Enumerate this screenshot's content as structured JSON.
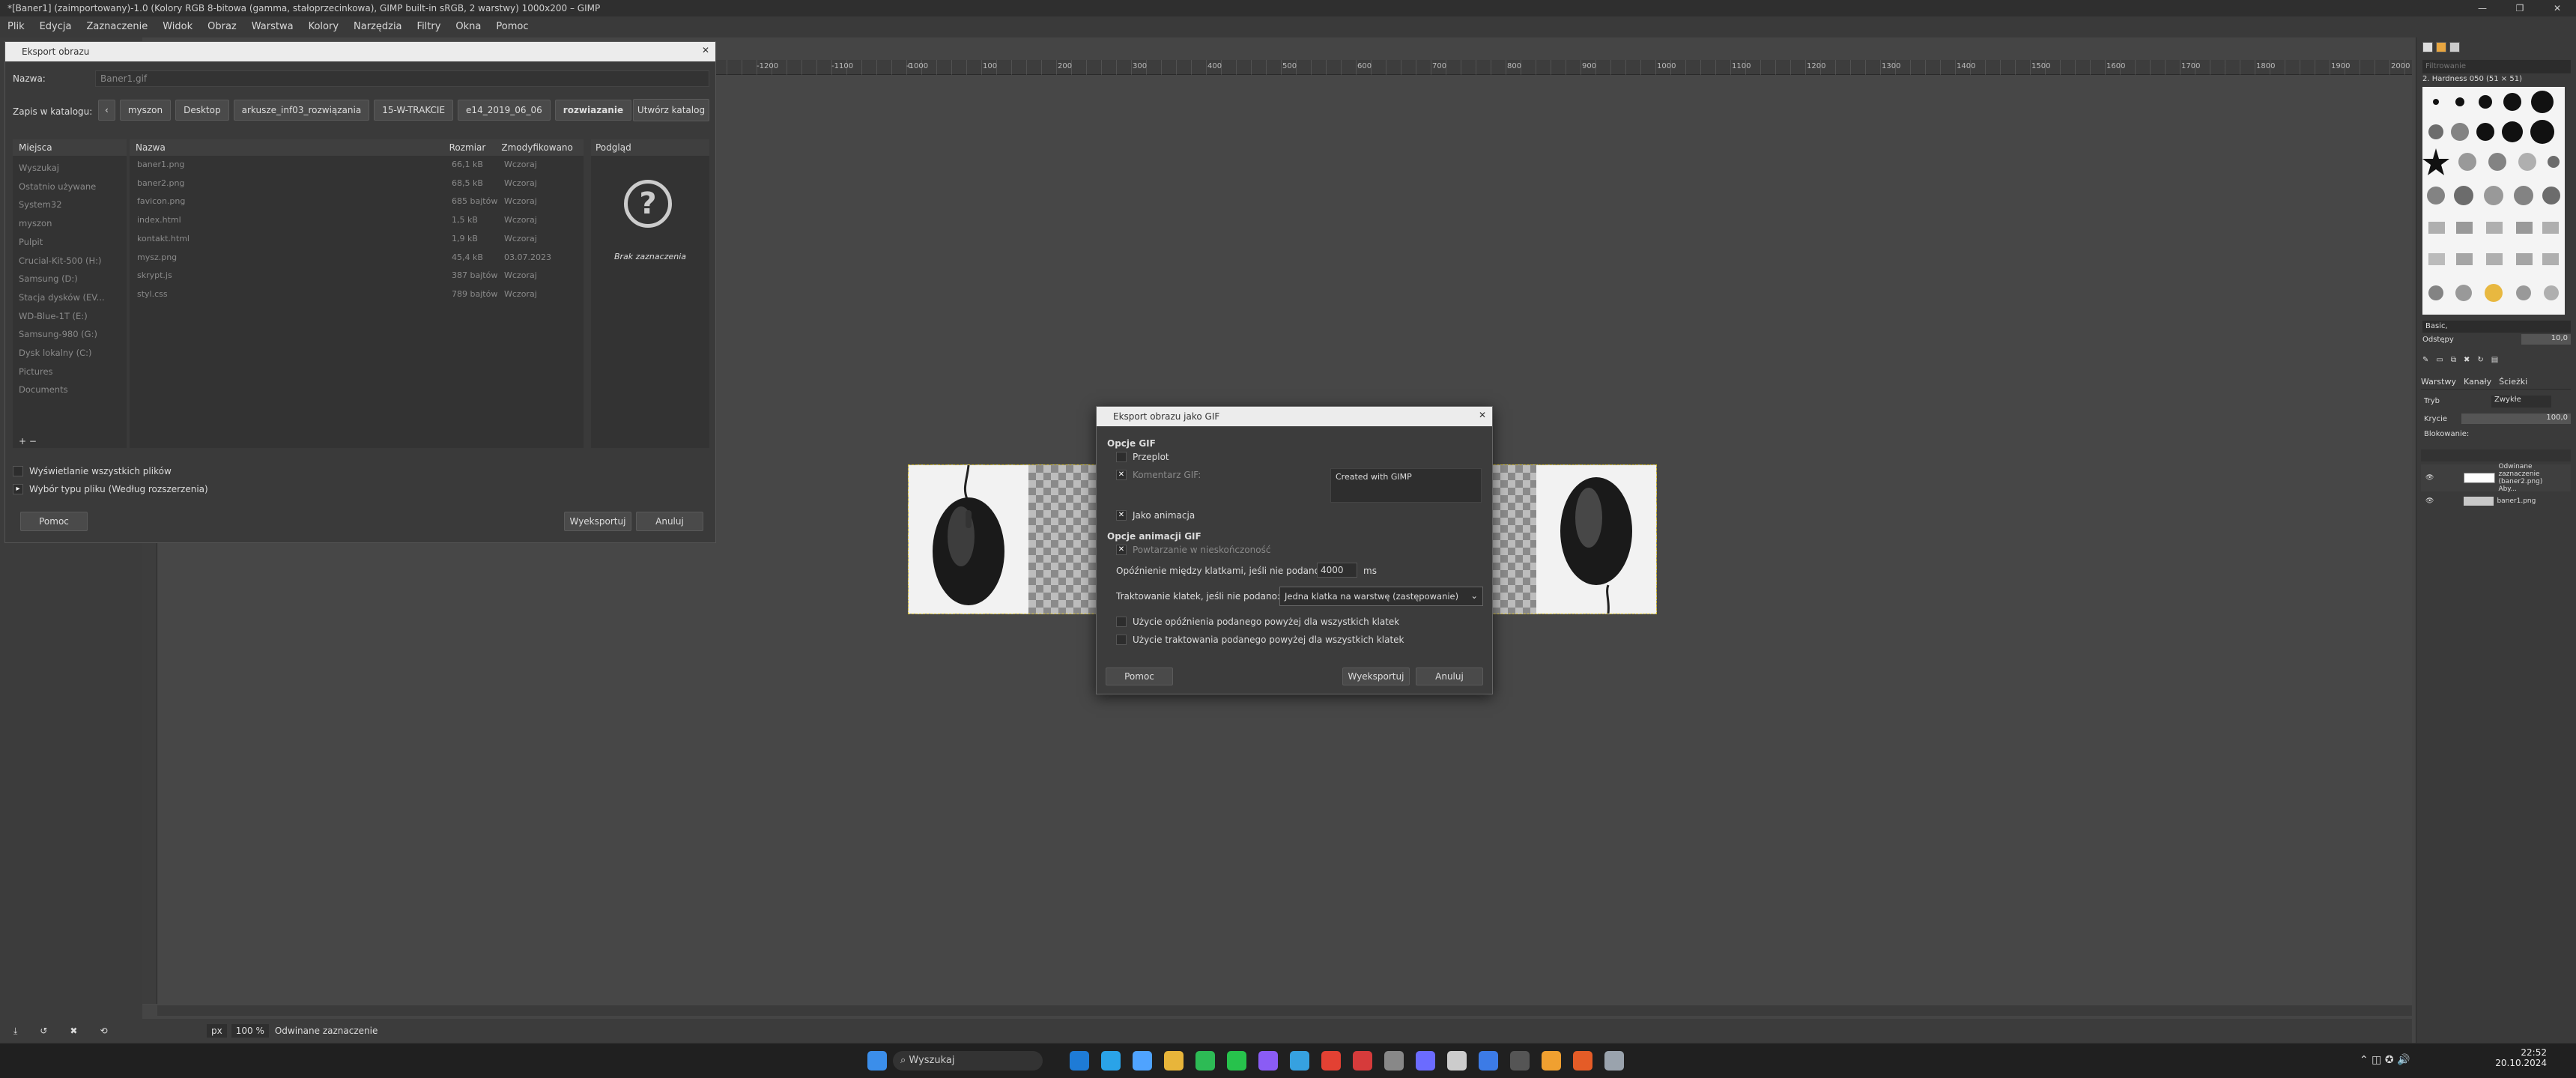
{
  "window": {
    "title": "*[Baner1] (zaimportowany)-1.0 (Kolory RGB 8-bitowa (gamma, stałoprzecinkowa), GIMP built-in sRGB, 2 warstwy) 1000x200 – GIMP",
    "controls": [
      "—",
      "❐",
      "✕"
    ]
  },
  "menu": [
    "Plik",
    "Edycja",
    "Zaznaczenie",
    "Widok",
    "Obraz",
    "Warstwa",
    "Kolory",
    "Narzędzia",
    "Filtry",
    "Okna",
    "Pomoc"
  ],
  "ruler": {
    "h_ticks": [
      "-1200",
      "-1100",
      "-1000",
      "0",
      "100",
      "200",
      "300",
      "400",
      "500",
      "600",
      "700",
      "800",
      "900",
      "1000",
      "1100",
      "1200",
      "1300",
      "1400",
      "1500",
      "1600",
      "1700",
      "1800",
      "1900",
      "2000"
    ]
  },
  "status": {
    "unit": "px",
    "zoom": "100 %",
    "text": "Odwinane zaznaczenie"
  },
  "export_dialog": {
    "title": "Eksport obrazu",
    "name_label": "Nazwa:",
    "name_value": "Baner1.gif",
    "folder_label": "Zapis w katalogu:",
    "breadcrumbs": [
      "myszon",
      "Desktop",
      "arkusze_inf03_rozwiązania",
      "15-W-TRAKCIE",
      "e14_2019_06_06",
      "rozwiazanie"
    ],
    "create_folder": "Utwórz katalog",
    "places_header": "Miejsca",
    "places": [
      "Wyszukaj",
      "Ostatnio używane",
      "System32",
      "myszon",
      "Pulpit",
      "Crucial-Kit-500 (H:)",
      "Samsung (D:)",
      "Stacja dysków (EV...",
      "WD-Blue-1T (E:)",
      "Samsung-980 (G:)",
      "Dysk lokalny (C:)",
      "Pictures",
      "Documents"
    ],
    "columns": {
      "name": "Nazwa",
      "size": "Rozmiar",
      "modified": "Zmodyfikowano"
    },
    "files": [
      {
        "name": "baner1.png",
        "size": "66,1 kB",
        "modified": "Wczoraj"
      },
      {
        "name": "baner2.png",
        "size": "68,5 kB",
        "modified": "Wczoraj"
      },
      {
        "name": "favicon.png",
        "size": "685 bajtów",
        "modified": "Wczoraj"
      },
      {
        "name": "index.html",
        "size": "1,5 kB",
        "modified": "Wczoraj"
      },
      {
        "name": "kontakt.html",
        "size": "1,9 kB",
        "modified": "Wczoraj"
      },
      {
        "name": "mysz.png",
        "size": "45,4 kB",
        "modified": "03.07.2023"
      },
      {
        "name": "skrypt.js",
        "size": "387 bajtów",
        "modified": "Wczoraj"
      },
      {
        "name": "styl.css",
        "size": "789 bajtów",
        "modified": "Wczoraj"
      }
    ],
    "preview_header": "Podgląd",
    "preview_empty": "Brak zaznaczenia",
    "show_all": "Wyświetlanie wszystkich plików",
    "file_type": "Wybór typu pliku (Według rozszerzenia)",
    "help": "Pomoc",
    "export": "Wyeksportuj",
    "cancel": "Anuluj"
  },
  "gif_dialog": {
    "title": "Eksport obrazu jako GIF",
    "section1": "Opcje GIF",
    "interlace": "Przeplot",
    "comment_label": "Komentarz GIF:",
    "comment_value": "Created with GIMP",
    "as_animation": "Jako animacja",
    "section2": "Opcje animacji GIF",
    "loop_forever": "Powtarzanie w nieskończoność",
    "delay_label": "Opóźnienie między klatkami, jeśli nie podano:",
    "delay_value": "4000",
    "delay_unit": "ms",
    "disposal_label": "Traktowanie klatek, jeśli nie podano:",
    "disposal_value": "Jedna klatka na warstwę (zastępowanie)",
    "use_delay_all": "Użycie opóźnienia podanego powyżej dla wszystkich klatek",
    "use_disposal_all": "Użycie traktowania podanego powyżej dla wszystkich klatek",
    "help": "Pomoc",
    "export": "Wyeksportuj",
    "cancel": "Anuluj"
  },
  "right_dock": {
    "filter_placeholder": "Filtrowanie",
    "brush_name": "2. Hardness 050 (51 × 51)",
    "brush_preset": "Basic,",
    "spacing_label": "Odstępy",
    "spacing_value": "10,0",
    "tabs": [
      "Warstwy",
      "Kanały",
      "Ścieżki"
    ],
    "mode_label": "Tryb",
    "mode_value": "Zwykłe",
    "opacity_label": "Krycie",
    "opacity_value": "100,0",
    "lock_label": "Blokowanie:",
    "layers": [
      "Odwinane zaznaczenie (baner2.png) Aby...",
      "baner1.png"
    ]
  },
  "taskbar": {
    "search_placeholder": "Wyszukaj",
    "time": "22:52",
    "date": "20.10.2024",
    "app_colors": [
      "#1e7bd6",
      "#2aa3e8",
      "#4fa3ff",
      "#e8b53a",
      "#2dbb55",
      "#27c24c",
      "#8a5cf5",
      "#36a1e0",
      "#e34133",
      "#d63b3b",
      "#888888",
      "#6b6bff",
      "#cccccc",
      "#3c7be6",
      "#555555",
      "#f0a030",
      "#e55c27",
      "#9aa3ad"
    ]
  }
}
